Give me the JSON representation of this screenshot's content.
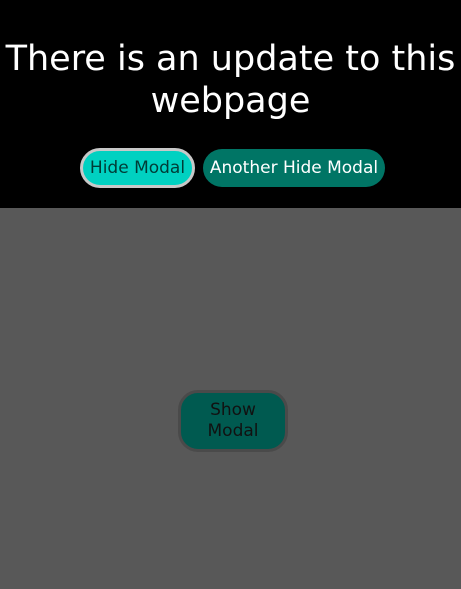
{
  "modal": {
    "title": "There is an update to this webpage",
    "hide_button_label": "Hide Modal",
    "another_hide_button_label": "Another Hide Modal"
  },
  "page": {
    "show_button_label": "Show Modal"
  },
  "colors": {
    "modal_background": "#000000",
    "page_background": "#585858",
    "hide_button": "#00d1c1",
    "another_hide_button": "#007565",
    "show_button": "#005a50"
  }
}
